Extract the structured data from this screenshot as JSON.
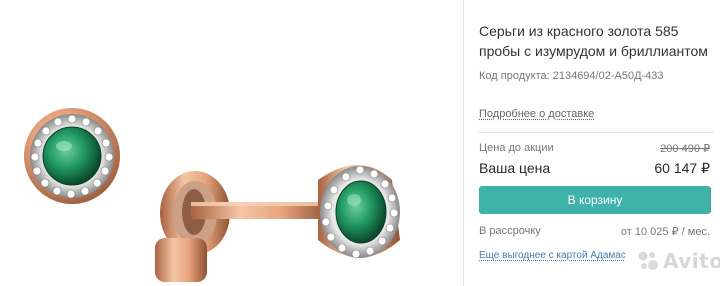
{
  "product": {
    "title": "Серьги из красного золота 585 пробы с изумрудом и бриллиантом",
    "code_label": "Код продукта:",
    "code_value": "2134694/02-А50Д-433",
    "delivery_link": "Подробнее о доставке"
  },
  "pricing": {
    "old_label": "Цена до акции",
    "old_value": "200 490 ₽",
    "new_label": "Ваша цена",
    "new_value": "60 147 ₽"
  },
  "cart_button": "В корзину",
  "installment": {
    "label": "В рассрочку",
    "value": "от 10 025 ₽ / мес."
  },
  "card_offer": "Еще выгоднее с картой Адамас",
  "watermark": "Avito",
  "colors": {
    "accent": "#3fb3a9",
    "link": "#3f7bb5",
    "text": "#2b2b2b",
    "muted": "#777777"
  },
  "icons": [
    "earring-photo",
    "avito-logo-icon"
  ]
}
